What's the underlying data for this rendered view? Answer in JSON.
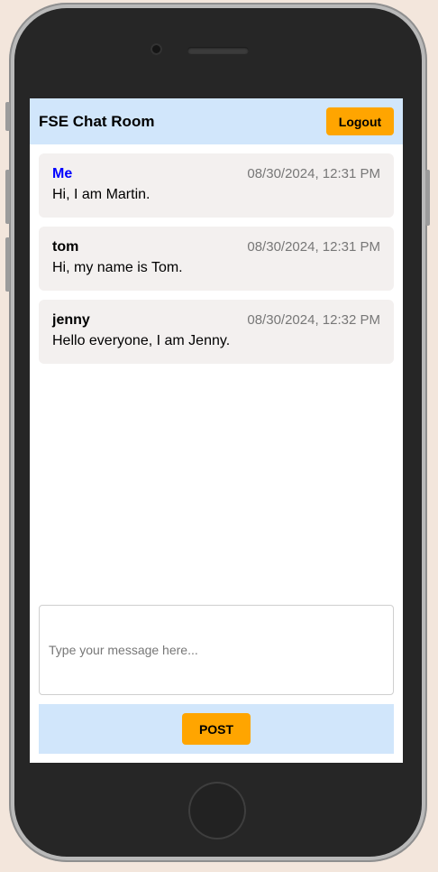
{
  "header": {
    "title": "FSE Chat Room",
    "logout_label": "Logout"
  },
  "messages": [
    {
      "author": "Me",
      "timestamp": "08/30/2024, 12:31 PM",
      "text": "Hi, I am Martin.",
      "is_self": true
    },
    {
      "author": "tom",
      "timestamp": "08/30/2024, 12:31 PM",
      "text": "Hi, my name is Tom.",
      "is_self": false
    },
    {
      "author": "jenny",
      "timestamp": "08/30/2024, 12:32 PM",
      "text": "Hello everyone, I am Jenny.",
      "is_self": false
    }
  ],
  "composer": {
    "placeholder": "Type your message here...",
    "value": ""
  },
  "post": {
    "label": "POST"
  },
  "colors": {
    "accent": "#ffa500",
    "header_bg": "#d1e6fb",
    "self_author": "#0000ff",
    "bubble_bg": "#f3f0ef"
  }
}
